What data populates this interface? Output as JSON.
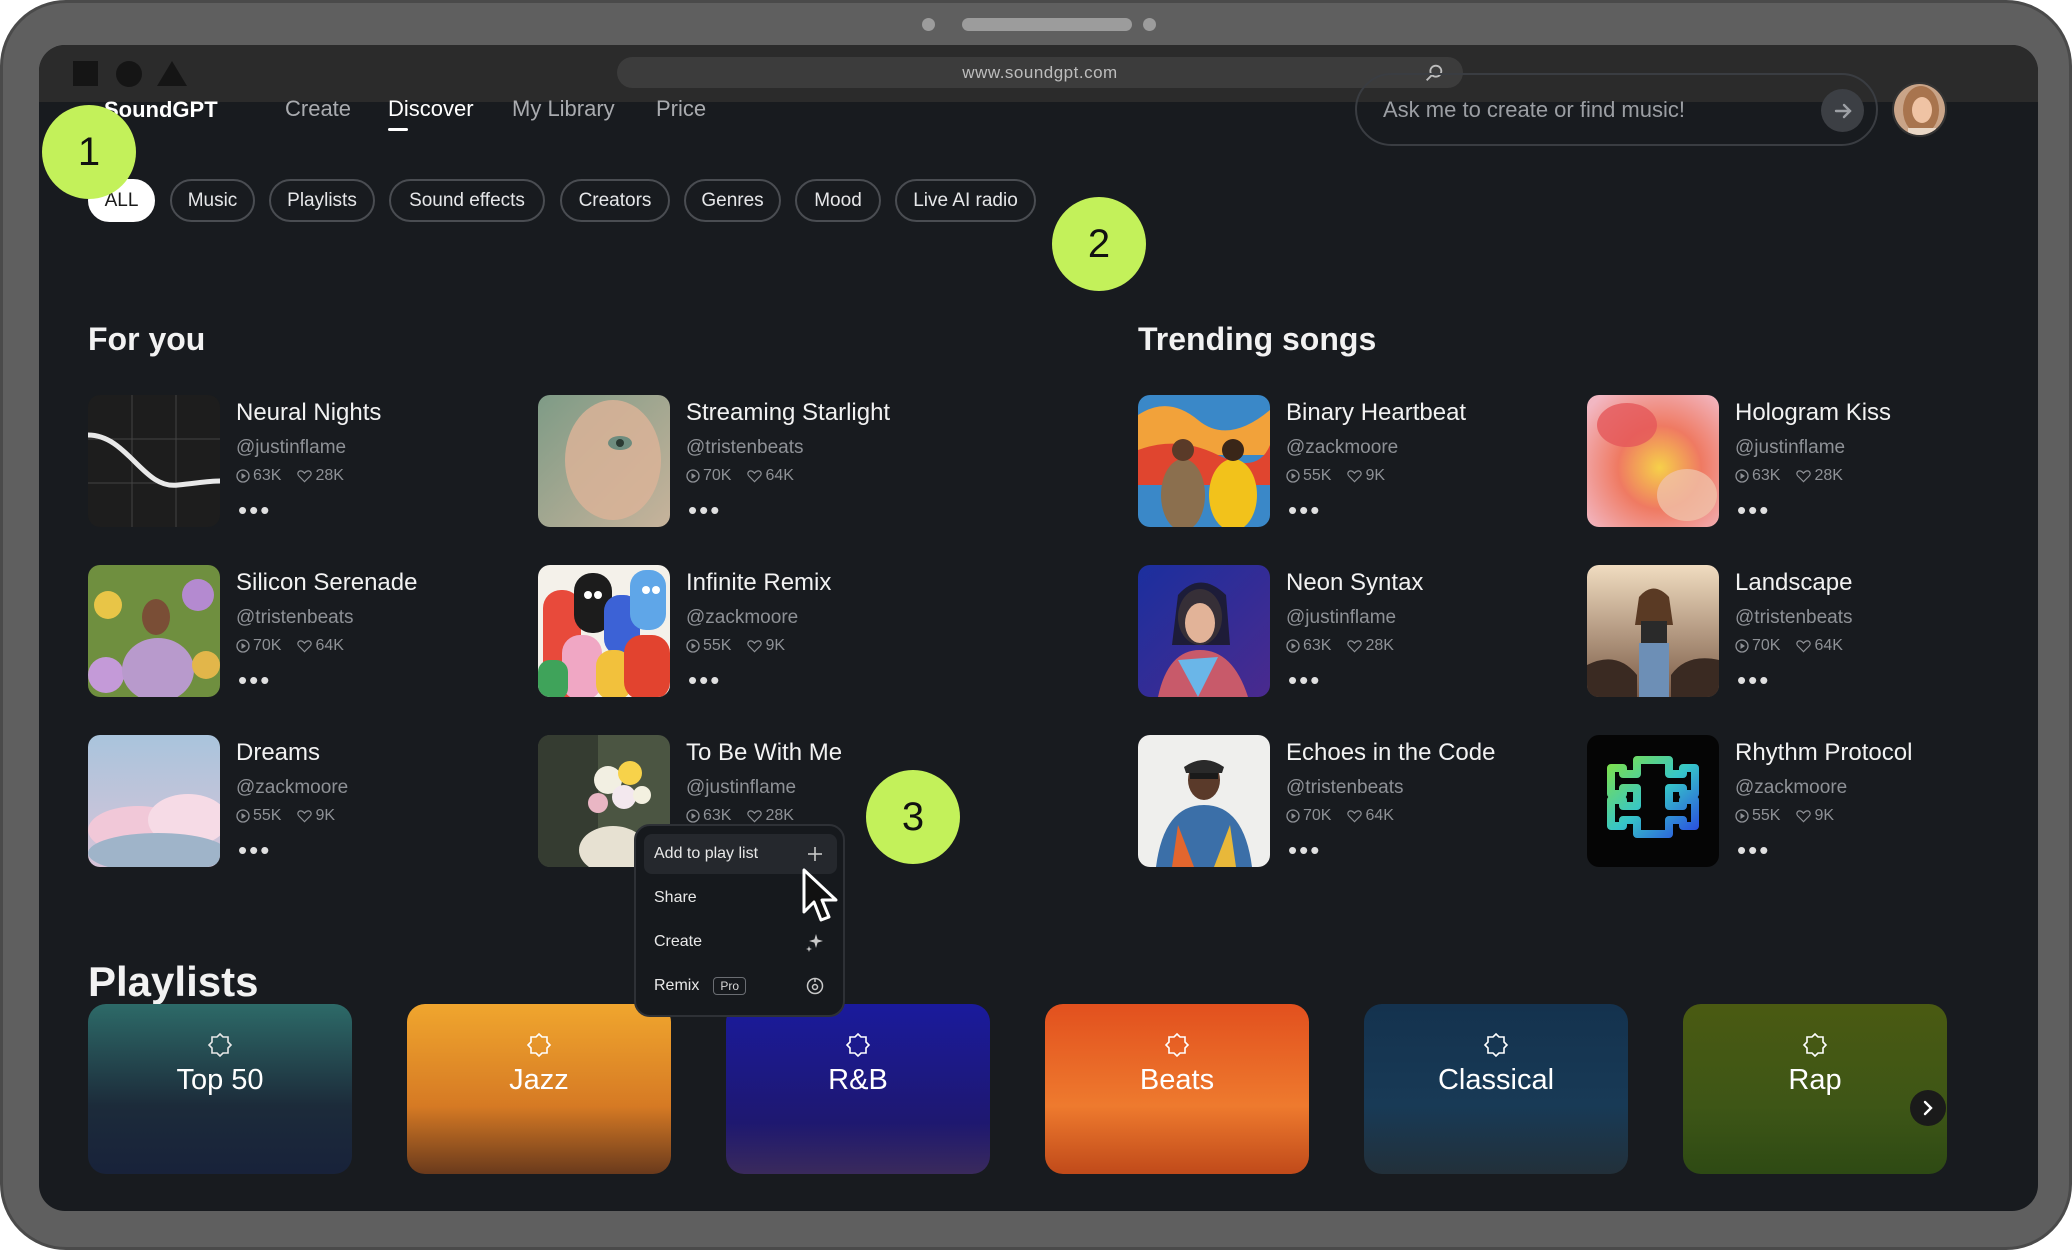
{
  "browser": {
    "url": "www.soundgpt.com"
  },
  "nav": {
    "brand": "SoundGPT",
    "links": [
      "Create",
      "Discover",
      "My Library",
      "Price"
    ],
    "active": "Discover",
    "search_placeholder": "Ask me to create or find music!"
  },
  "filters": [
    "ALL",
    "Music",
    "Playlists",
    "Sound effects",
    "Creators",
    "Genres",
    "Mood",
    "Live AI radio"
  ],
  "active_filter": "ALL",
  "callouts": [
    "1",
    "2",
    "3"
  ],
  "for_you": {
    "title": "For you",
    "songs": [
      {
        "title": "Neural Nights",
        "handle": "@justinflame",
        "plays": "63K",
        "likes": "28K"
      },
      {
        "title": "Streaming Starlight",
        "handle": "@tristenbeats",
        "plays": "70K",
        "likes": "64K"
      },
      {
        "title": "Silicon Serenade",
        "handle": "@tristenbeats",
        "plays": "70K",
        "likes": "64K"
      },
      {
        "title": "Infinite Remix",
        "handle": "@zackmoore",
        "plays": "55K",
        "likes": "9K"
      },
      {
        "title": "Dreams",
        "handle": "@zackmoore",
        "plays": "55K",
        "likes": "9K"
      },
      {
        "title": "To Be With Me",
        "handle": "@justinflame",
        "plays": "63K",
        "likes": "28K"
      }
    ]
  },
  "trending": {
    "title": "Trending songs",
    "songs": [
      {
        "title": "Binary Heartbeat",
        "handle": "@zackmoore",
        "plays": "55K",
        "likes": "9K"
      },
      {
        "title": "Hologram Kiss",
        "handle": "@justinflame",
        "plays": "63K",
        "likes": "28K"
      },
      {
        "title": "Neon Syntax",
        "handle": "@justinflame",
        "plays": "63K",
        "likes": "28K"
      },
      {
        "title": "Landscape",
        "handle": "@tristenbeats",
        "plays": "70K",
        "likes": "64K"
      },
      {
        "title": "Echoes in the Code",
        "handle": "@tristenbeats",
        "plays": "70K",
        "likes": "64K"
      },
      {
        "title": "Rhythm Protocol",
        "handle": "@zackmoore",
        "plays": "55K",
        "likes": "9K"
      }
    ]
  },
  "context_menu": {
    "items": [
      "Add to play list",
      "Share",
      "Create",
      "Remix"
    ],
    "remix_badge": "Pro",
    "hovered": "Add to play list"
  },
  "playlists": {
    "title": "Playlists",
    "items": [
      "Top 50",
      "Jazz",
      "R&B",
      "Beats",
      "Classical",
      "Rap"
    ]
  },
  "colors": {
    "background": "#181b1f",
    "callout": "#c3f15a",
    "chip_border": "#4a4d52",
    "text_muted": "#8e9196"
  },
  "icons": [
    "search-icon",
    "arrow-right-icon",
    "play-icon",
    "heart-icon",
    "more-icon",
    "plus-icon",
    "share-icon",
    "sparkle-icon",
    "remix-icon",
    "playlist-icon",
    "chevron-right-icon",
    "cursor-icon"
  ]
}
